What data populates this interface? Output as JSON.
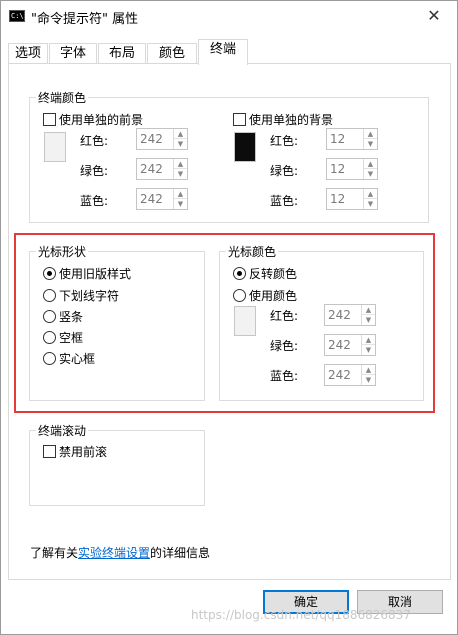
{
  "window": {
    "title": "\"命令提示符\" 属性",
    "close_symbol": "✕",
    "icon_text": "C:\\"
  },
  "tabs": [
    {
      "label": "选项"
    },
    {
      "label": "字体"
    },
    {
      "label": "布局"
    },
    {
      "label": "颜色"
    },
    {
      "label": "终端"
    }
  ],
  "terminal_colors": {
    "title": "终端颜色",
    "foreground": {
      "checkbox_label": "使用单独的前景",
      "red_label": "红色:",
      "red_value": "242",
      "green_label": "绿色:",
      "green_value": "242",
      "blue_label": "蓝色:",
      "blue_value": "242",
      "swatch_color": "#f2f2f2"
    },
    "background": {
      "checkbox_label": "使用单独的背景",
      "red_label": "红色:",
      "red_value": "12",
      "green_label": "绿色:",
      "green_value": "12",
      "blue_label": "蓝色:",
      "blue_value": "12",
      "swatch_color": "#0c0c0c"
    }
  },
  "cursor_shape": {
    "title": "光标形状",
    "options": [
      {
        "label": "使用旧版样式",
        "checked": true
      },
      {
        "label": "下划线字符",
        "checked": false
      },
      {
        "label": "竖条",
        "checked": false
      },
      {
        "label": "空框",
        "checked": false
      },
      {
        "label": "实心框",
        "checked": false
      }
    ]
  },
  "cursor_color": {
    "title": "光标颜色",
    "options": [
      {
        "label": "反转颜色",
        "checked": true
      },
      {
        "label": "使用颜色",
        "checked": false
      }
    ],
    "red_label": "红色:",
    "red_value": "242",
    "green_label": "绿色:",
    "green_value": "242",
    "blue_label": "蓝色:",
    "blue_value": "242",
    "swatch_color": "#f2f2f2"
  },
  "terminal_scroll": {
    "title": "终端滚动",
    "checkbox_label": "禁用前滚"
  },
  "info": {
    "prefix": "了解有关",
    "link": "实验终端设置",
    "suffix": "的详细信息"
  },
  "buttons": {
    "ok": "确定",
    "cancel": "取消"
  },
  "watermark": "https://blog.csdn.net/qq1886826837",
  "colors": {
    "accent": "#0078d7",
    "highlight_border": "#e33b3b",
    "link": "#0066cc"
  },
  "icons": {
    "spin_up": "▲",
    "spin_down": "▼"
  }
}
